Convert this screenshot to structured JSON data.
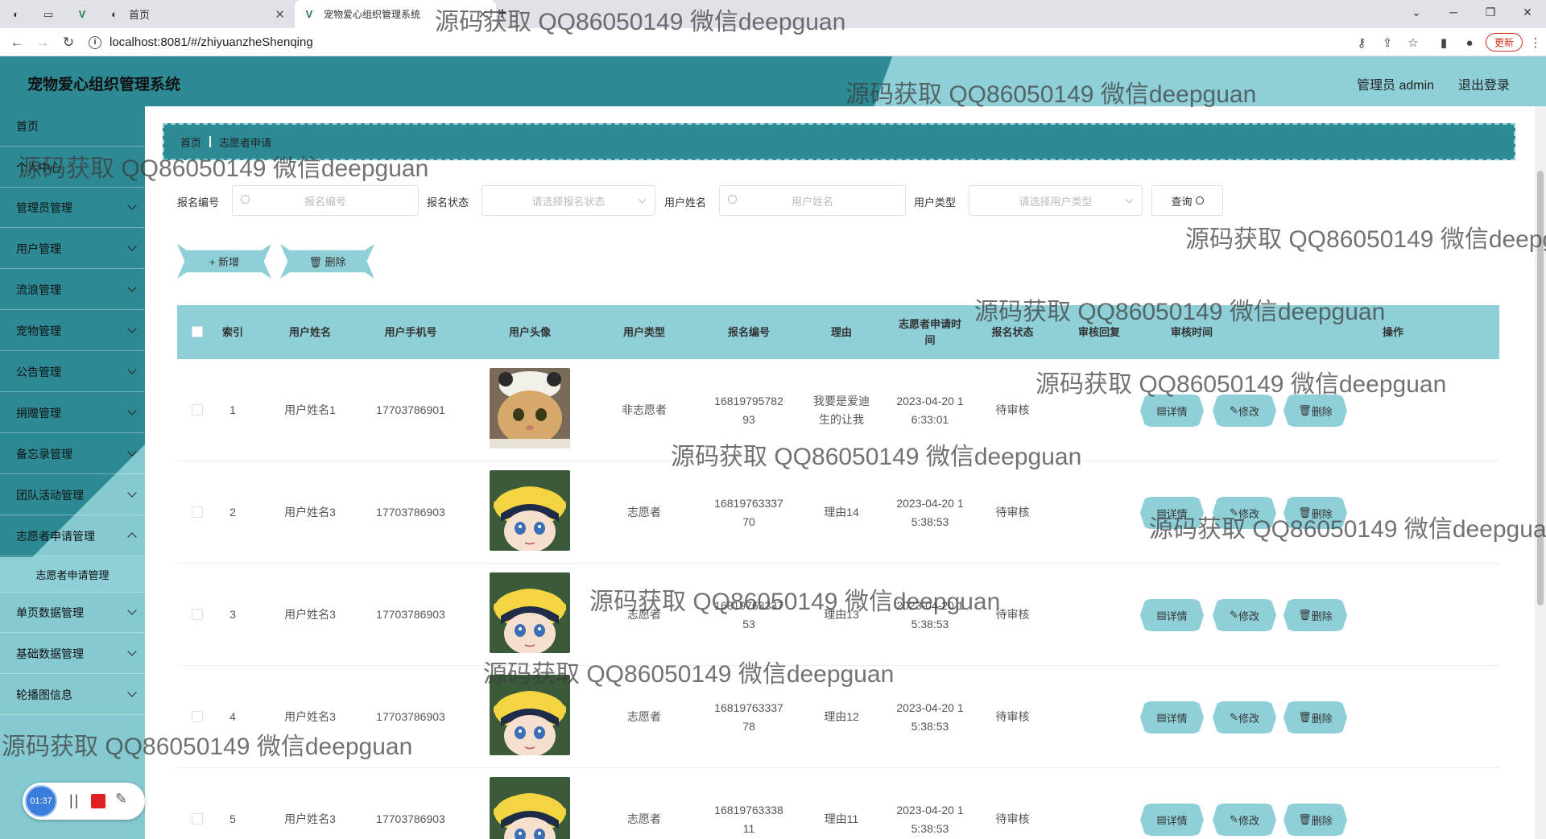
{
  "browser": {
    "tabs": [
      {
        "label": ""
      },
      {
        "label": ""
      },
      {
        "label": "首页"
      },
      {
        "label": "宠物爱心组织管理系统"
      }
    ],
    "new_tab": "+",
    "url": "localhost:8081/#/zhiyuanzheShenqing",
    "update_label": "更新"
  },
  "header": {
    "title": "宠物爱心组织管理系统",
    "admin": "管理员 admin",
    "logout": "退出登录"
  },
  "sidebar": {
    "items": [
      {
        "label": "首页"
      },
      {
        "label": "个人中心"
      },
      {
        "label": "管理员管理"
      },
      {
        "label": "用户管理"
      },
      {
        "label": "流浪管理"
      },
      {
        "label": "宠物管理"
      },
      {
        "label": "公告管理"
      },
      {
        "label": "捐赠管理"
      },
      {
        "label": "备忘录管理"
      },
      {
        "label": "团队活动管理"
      },
      {
        "label": "志愿者申请管理"
      },
      {
        "label": "志愿者申请管理"
      },
      {
        "label": "单页数据管理"
      },
      {
        "label": "基础数据管理"
      },
      {
        "label": "轮播图信息"
      }
    ]
  },
  "recorder": {
    "time": "01:37",
    "pause": "||",
    "pen": "✎"
  },
  "breadcrumb": {
    "home": "首页",
    "current": "志愿者申请"
  },
  "search": {
    "f1_label": "报名编号",
    "f1_placeholder": "报名编号",
    "f2_label": "报名状态",
    "f2_placeholder": "请选择报名状态",
    "f3_label": "用户姓名",
    "f3_placeholder": "用户姓名",
    "f4_label": "用户类型",
    "f4_placeholder": "请选择用户类型",
    "query": "查询"
  },
  "actions": {
    "add": "+ 新增",
    "delete": "🗑 删除"
  },
  "table": {
    "headers": {
      "index": "索引",
      "name": "用户姓名",
      "phone": "用户手机号",
      "avatar": "用户头像",
      "type": "用户类型",
      "code": "报名编号",
      "reason": "理由",
      "apply_time": "志愿者申请时间",
      "status": "报名状态",
      "reply": "审核回复",
      "review_time": "审核时间",
      "ops": "操作"
    },
    "rows": [
      {
        "index": "1",
        "name": "用户姓名1",
        "phone": "17703786901",
        "avatar": "cat",
        "type": "非志愿者",
        "code": "1681979578293",
        "reason": "我要是爱迪生的让我",
        "apply_time": "2023-04-20 16:33:01",
        "status": "待审核"
      },
      {
        "index": "2",
        "name": "用户姓名3",
        "phone": "17703786903",
        "avatar": "boy",
        "type": "志愿者",
        "code": "1681976333770",
        "reason": "理由14",
        "apply_time": "2023-04-20 15:38:53",
        "status": "待审核"
      },
      {
        "index": "3",
        "name": "用户姓名3",
        "phone": "17703786903",
        "avatar": "boy",
        "type": "志愿者",
        "code": "1681976333753",
        "reason": "理由13",
        "apply_time": "2023-04-20 15:38:53",
        "status": "待审核"
      },
      {
        "index": "4",
        "name": "用户姓名3",
        "phone": "17703786903",
        "avatar": "boy",
        "type": "志愿者",
        "code": "1681976333778",
        "reason": "理由12",
        "apply_time": "2023-04-20 15:38:53",
        "status": "待审核"
      },
      {
        "index": "5",
        "name": "用户姓名3",
        "phone": "17703786903",
        "avatar": "boy",
        "type": "志愿者",
        "code": "1681976333811",
        "reason": "理由11",
        "apply_time": "2023-04-20 15:38:53",
        "status": "待审核"
      }
    ],
    "op_labels": {
      "detail": "详情",
      "edit": "修改",
      "delete": "删除"
    }
  },
  "watermark": "源码获取 QQ86050149 微信deepguan",
  "colors": {
    "primary": "#2d8a94",
    "accent": "#8fd0d8"
  }
}
